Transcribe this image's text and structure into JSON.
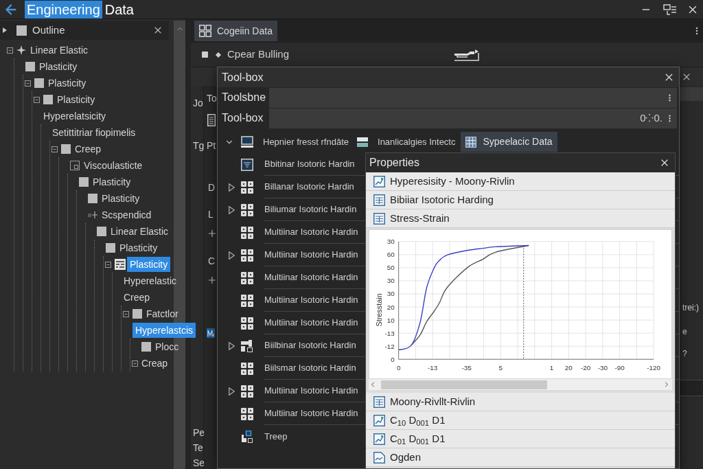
{
  "title_bar": {
    "words": [
      {
        "text": "Engineering",
        "highlighted": true
      },
      {
        "text": "Data",
        "highlighted": false
      }
    ]
  },
  "outline": {
    "title": "Outline",
    "items": [
      {
        "label": "Linear Elastic",
        "kind": "sparkle",
        "toggle": true,
        "selected": false,
        "children": [
          {
            "label": "Plasticity",
            "kind": "square",
            "toggle": false,
            "selected": false,
            "children": [
              {
                "label": "Plasticity",
                "kind": "square",
                "toggle": true,
                "selected": false,
                "children": [
                  {
                    "label": "Plasticity",
                    "kind": "square",
                    "toggle": true,
                    "selected": false
                  },
                  {
                    "label": "Hyperelatsicity",
                    "toggle": false,
                    "selected": false,
                    "children": [
                      {
                        "label": "Setittitriar fiopimelis",
                        "toggle": false,
                        "selected": false,
                        "children": [
                          {
                            "label": "Creep",
                            "kind": "square",
                            "toggle": true,
                            "selected": false,
                            "children": [
                              {
                                "label": "Viscoulasticte",
                                "kind": "frame",
                                "toggle": false,
                                "selected": false,
                                "children": [
                                  {
                                    "label": "Plasticity",
                                    "kind": "square",
                                    "toggle": false,
                                    "selected": false,
                                    "children": [
                                      {
                                        "label": "Plasticity",
                                        "kind": "square",
                                        "toggle": false,
                                        "selected": false
                                      },
                                      {
                                        "label": "Scspendicd",
                                        "kind": "cross",
                                        "toggle": false,
                                        "selected": false,
                                        "children": [
                                          {
                                            "label": "Linear Elastic",
                                            "kind": "square",
                                            "toggle": false,
                                            "selected": false,
                                            "children": [
                                              {
                                                "label": "Plasticity",
                                                "kind": "square",
                                                "toggle": false,
                                                "selected": false,
                                                "children": [
                                                  {
                                                    "label": "Plasticity",
                                                    "kind": "thumbnail",
                                                    "toggle": true,
                                                    "selected": true,
                                                    "children": [
                                                      {
                                                        "label": "Hyperelastic",
                                                        "toggle": false,
                                                        "selected": false
                                                      },
                                                      {
                                                        "label": "Creep",
                                                        "toggle": false,
                                                        "selected": false,
                                                        "children": [
                                                          {
                                                            "label": "Fatctlor",
                                                            "kind": "square",
                                                            "toggle": true,
                                                            "selected": false
                                                          },
                                                          {
                                                            "label": "Hyperelastcis",
                                                            "toggle": false,
                                                            "selected": true,
                                                            "children": [
                                                              {
                                                                "label": "Plocc",
                                                                "kind": "square",
                                                                "toggle": false,
                                                                "selected": false
                                                              },
                                                              {
                                                                "label": "Creap",
                                                                "toggle": true,
                                                                "selected": false
                                                              }
                                                            ]
                                                          }
                                                        ]
                                                      }
                                                    ]
                                                  }
                                                ]
                                              }
                                            ]
                                          }
                                        ]
                                      }
                                    ]
                                  }
                                ]
                              }
                            ]
                          }
                        ]
                      }
                    ]
                  }
                ]
              }
            ]
          }
        ]
      }
    ]
  },
  "back_window": {
    "tab": {
      "label": "Cogeiin Data",
      "selected": true
    },
    "toolbar_label": "Cpear Bulling",
    "left_column": [
      "Jo",
      "Tg",
      "Pe",
      "Te",
      "Se"
    ],
    "side_column": [
      "To",
      "Pt",
      "D",
      "L",
      "C"
    ],
    "right_column": [
      "trei:)",
      "e",
      "?"
    ]
  },
  "toolbox": {
    "title": "Tool-box",
    "fields": [
      {
        "label": "Toolsbne"
      },
      {
        "label": "Tool-box",
        "value": "0⁘0."
      }
    ],
    "header": {
      "expanded": true,
      "tabs": [
        {
          "label": "Hepnier fresst rfndâte",
          "selected": false
        },
        {
          "label": "Inanlicalgies Intectc",
          "selected": false
        },
        {
          "label": "Sypeelacic Data",
          "selected": true
        }
      ]
    },
    "rows": [
      {
        "label": "Bbitinar Isotoric Hardin",
        "expandable": false,
        "kind": "panel"
      },
      {
        "label": "Billanar Isotoric Hardin",
        "expandable": true,
        "kind": "grid"
      },
      {
        "label": "Biliumar Isotoric Hardin",
        "expandable": true,
        "kind": "grid"
      },
      {
        "label": "Multiinar Isotoric Hardin",
        "expandable": false,
        "kind": "grid"
      },
      {
        "label": "Multiinar Isotoric Hardin",
        "expandable": true,
        "kind": "grid"
      },
      {
        "label": "Multiinar Isotoric Hardin",
        "expandable": false,
        "kind": "grid"
      },
      {
        "label": "Multiinar Isotoric Hardin",
        "expandable": false,
        "kind": "grid"
      },
      {
        "label": "Multiinar Isotoric Hardin",
        "expandable": false,
        "kind": "grid"
      },
      {
        "label": "Biilbinar Isotoric Hardin",
        "expandable": true,
        "kind": "blocks"
      },
      {
        "label": "Biilsmar Isotoric Hardin",
        "expandable": false,
        "kind": "grid"
      },
      {
        "label": "Multiinar Isotoric Hardin",
        "expandable": true,
        "kind": "grid"
      },
      {
        "label": "Multiinar Isotoric Hardin",
        "expandable": false,
        "kind": "grid"
      },
      {
        "label": "Treep",
        "expandable": false,
        "kind": "node"
      }
    ]
  },
  "properties": {
    "title": "Properties",
    "items_above": [
      {
        "label": "Hyperesisity - Moony-Rivlin",
        "kind": "plot"
      },
      {
        "label": "Bibiiar Isotoric Harding",
        "kind": "table"
      },
      {
        "label": "Stress-Strain",
        "kind": "table"
      }
    ],
    "chart": {
      "y_title": "Stresstain",
      "y_labels": [
        "30",
        "60",
        "50",
        "30",
        "30",
        "20",
        "10",
        "-13",
        "-12",
        "0"
      ],
      "x_labels": [
        "0",
        "-13",
        "-35",
        "5",
        "1",
        "20",
        "-20",
        "-30",
        "-90",
        "-120"
      ]
    },
    "items_below": [
      {
        "label": "Moony-Rivllt-Rivlin",
        "kind": "table"
      },
      {
        "label": "C$_{10}$  D$_{001}$ D1",
        "kind": "plot"
      },
      {
        "label": "C$_{01}$  D$_{001}$ D1",
        "kind": "plot"
      },
      {
        "label": "Ogden",
        "kind": "sheet"
      }
    ]
  }
}
